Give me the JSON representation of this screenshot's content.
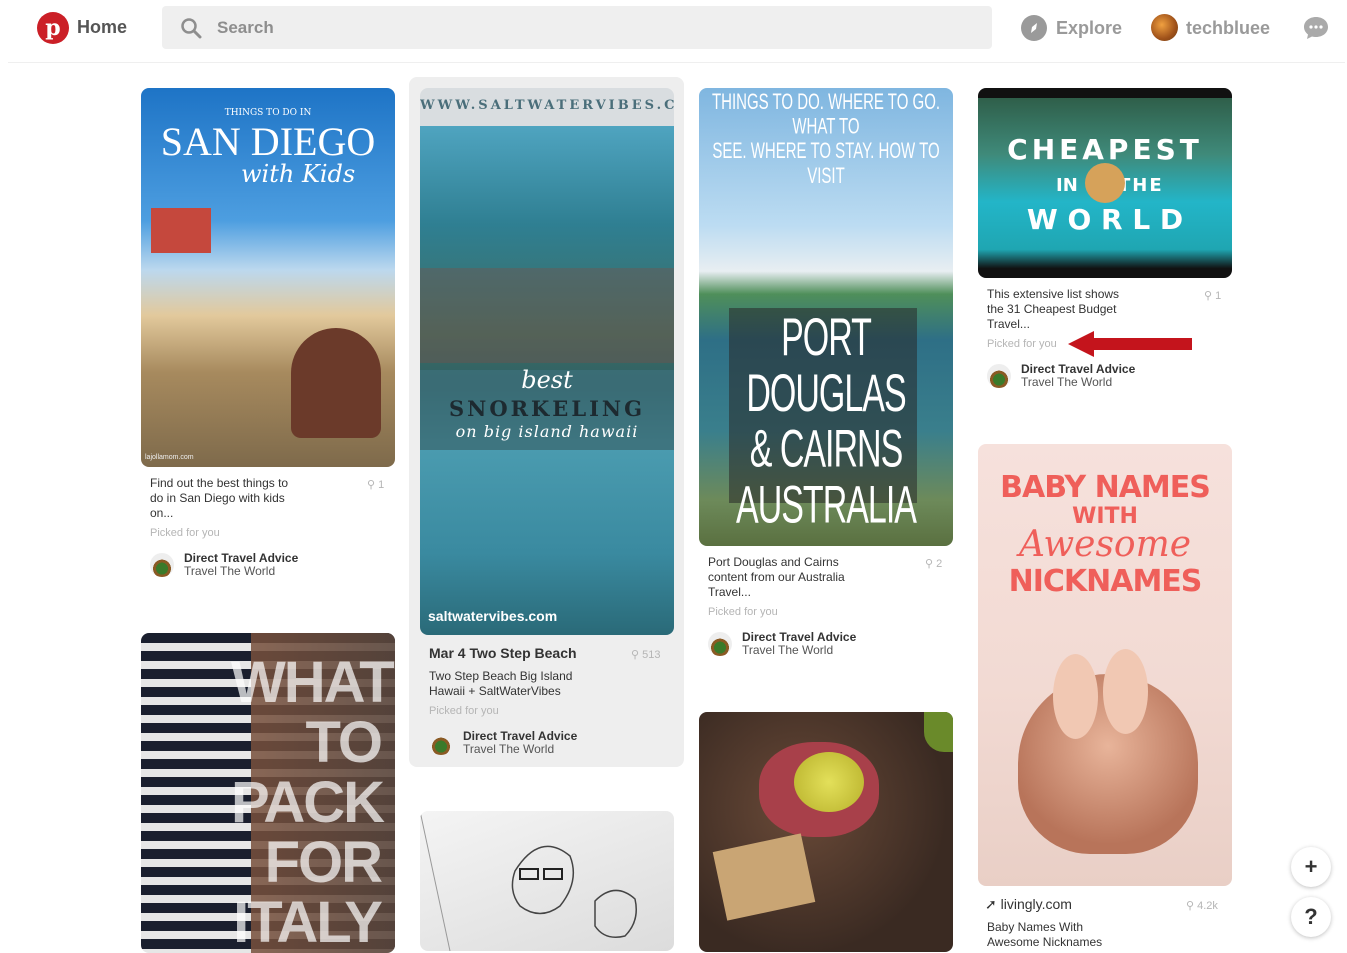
{
  "header": {
    "home_label": "Home",
    "search_placeholder": "Search",
    "explore_label": "Explore",
    "username": "techbluee"
  },
  "pins": [
    {
      "overlay_kicker": "THINGS TO DO IN",
      "overlay_title": "SAN DIEGO",
      "overlay_sub": "with Kids",
      "watermark": "lajollamom.com",
      "description": [
        "Find out the best things to",
        "do in San Diego with kids",
        "on..."
      ],
      "saves": "1",
      "picked": "Picked for you",
      "board_name": "Direct Travel Advice",
      "board_sub": "Travel The World"
    },
    {
      "overlay_url": "WWW.SALTWATERVIBES.COM",
      "overlay_best": "best",
      "overlay_main": "SNORKELING",
      "overlay_sub": "on big island hawaii",
      "watermark": "saltwatervibes.com",
      "title": "Mar 4 Two Step Beach",
      "description": [
        "Two Step Beach Big Island",
        "Hawaii + SaltWaterVibes"
      ],
      "saves": "513",
      "picked": "Picked for you",
      "board_name": "Direct Travel Advice",
      "board_sub": "Travel The World"
    },
    {
      "overlay_top1": "THINGS TO DO. WHERE TO GO. WHAT TO",
      "overlay_top2": "SEE. WHERE TO STAY. HOW TO VISIT",
      "overlay_line1": "PORT DOUGLAS",
      "overlay_line2": "& CAIRNS",
      "overlay_line3": "AUSTRALIA",
      "description": [
        "Port Douglas and Cairns",
        "content from our Australia",
        "Travel..."
      ],
      "saves": "2",
      "picked": "Picked for you",
      "board_name": "Direct Travel Advice",
      "board_sub": "Travel The World"
    },
    {
      "overlay_line1": "CHEAPEST",
      "overlay_in": "IN",
      "overlay_the": "THE",
      "overlay_line3": "W O R L D",
      "description": [
        "This extensive list shows",
        "the 31 Cheapest Budget",
        "Travel..."
      ],
      "saves": "1",
      "picked": "Picked for you",
      "board_name": "Direct Travel Advice",
      "board_sub": "Travel The World"
    },
    {
      "overlay_line1": "BABY NAMES",
      "overlay_with": "WITH",
      "overlay_awesome": "Awesome",
      "overlay_line3": "NICKNAMES",
      "source": "livingly.com",
      "saves": "4.2k",
      "description": [
        "Baby Names With",
        "Awesome Nicknames"
      ]
    },
    {
      "overlay_line1": "WHAT",
      "overlay_line2": "TO",
      "overlay_line3": "PACK",
      "overlay_line4": "FOR",
      "overlay_line5": "ITALY"
    }
  ],
  "fab": {
    "add": "+",
    "help": "?"
  },
  "colors": {
    "brand": "#cb1f27",
    "arrow": "#c4141c"
  }
}
